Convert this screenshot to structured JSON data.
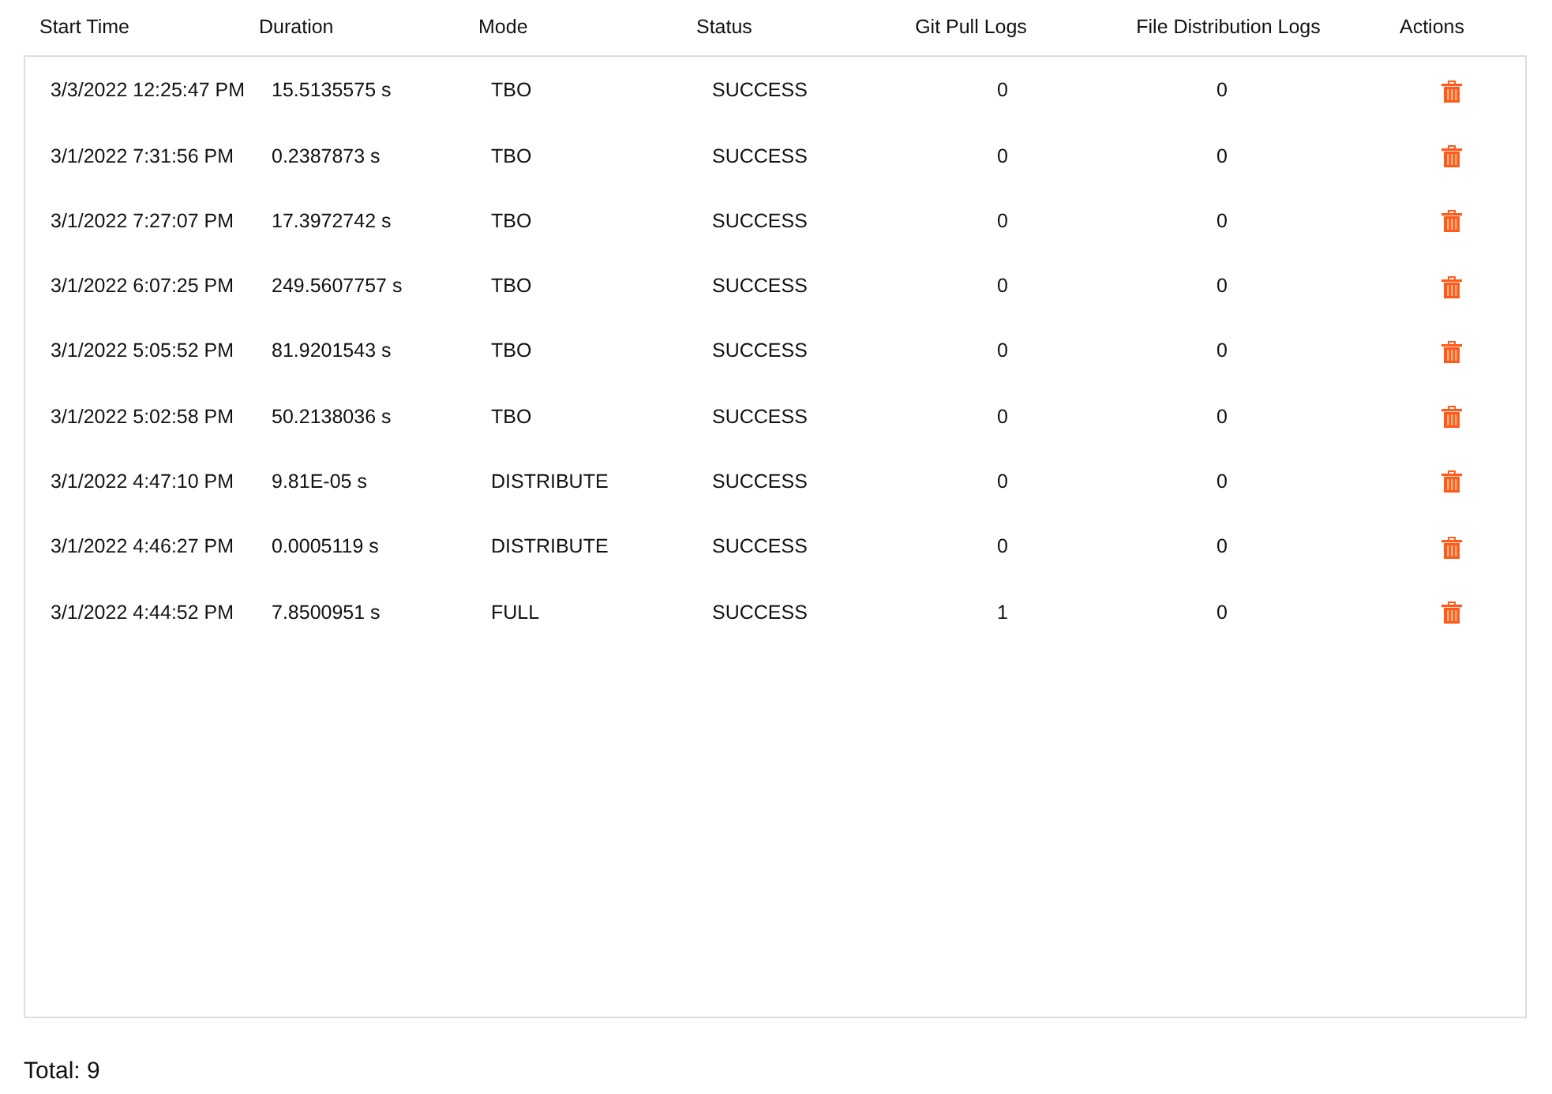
{
  "table": {
    "columns": [
      "Start Time",
      "Duration",
      "Mode",
      "Status",
      "Git Pull Logs",
      "File Distribution Logs",
      "Actions"
    ],
    "rows": [
      {
        "start_time": "3/3/2022 12:25:47 PM",
        "duration": "15.5135575 s",
        "mode": "TBO",
        "status": "SUCCESS",
        "git_pull_logs": "0",
        "file_distribution_logs": "0"
      },
      {
        "start_time": "3/1/2022 7:31:56 PM",
        "duration": "0.2387873 s",
        "mode": "TBO",
        "status": "SUCCESS",
        "git_pull_logs": "0",
        "file_distribution_logs": "0"
      },
      {
        "start_time": "3/1/2022 7:27:07 PM",
        "duration": "17.3972742 s",
        "mode": "TBO",
        "status": "SUCCESS",
        "git_pull_logs": "0",
        "file_distribution_logs": "0"
      },
      {
        "start_time": "3/1/2022 6:07:25 PM",
        "duration": "249.5607757 s",
        "mode": "TBO",
        "status": "SUCCESS",
        "git_pull_logs": "0",
        "file_distribution_logs": "0"
      },
      {
        "start_time": "3/1/2022 5:05:52 PM",
        "duration": "81.9201543 s",
        "mode": "TBO",
        "status": "SUCCESS",
        "git_pull_logs": "0",
        "file_distribution_logs": "0"
      },
      {
        "start_time": "3/1/2022 5:02:58 PM",
        "duration": "50.2138036 s",
        "mode": "TBO",
        "status": "SUCCESS",
        "git_pull_logs": "0",
        "file_distribution_logs": "0"
      },
      {
        "start_time": "3/1/2022 4:47:10 PM",
        "duration": "9.81E-05 s",
        "mode": "DISTRIBUTE",
        "status": "SUCCESS",
        "git_pull_logs": "0",
        "file_distribution_logs": "0"
      },
      {
        "start_time": "3/1/2022 4:46:27 PM",
        "duration": "0.0005119 s",
        "mode": "DISTRIBUTE",
        "status": "SUCCESS",
        "git_pull_logs": "0",
        "file_distribution_logs": "0"
      },
      {
        "start_time": "3/1/2022 4:44:52 PM",
        "duration": "7.8500951 s",
        "mode": "FULL",
        "status": "SUCCESS",
        "git_pull_logs": "1",
        "file_distribution_logs": "0"
      }
    ]
  },
  "total": "Total: 9"
}
